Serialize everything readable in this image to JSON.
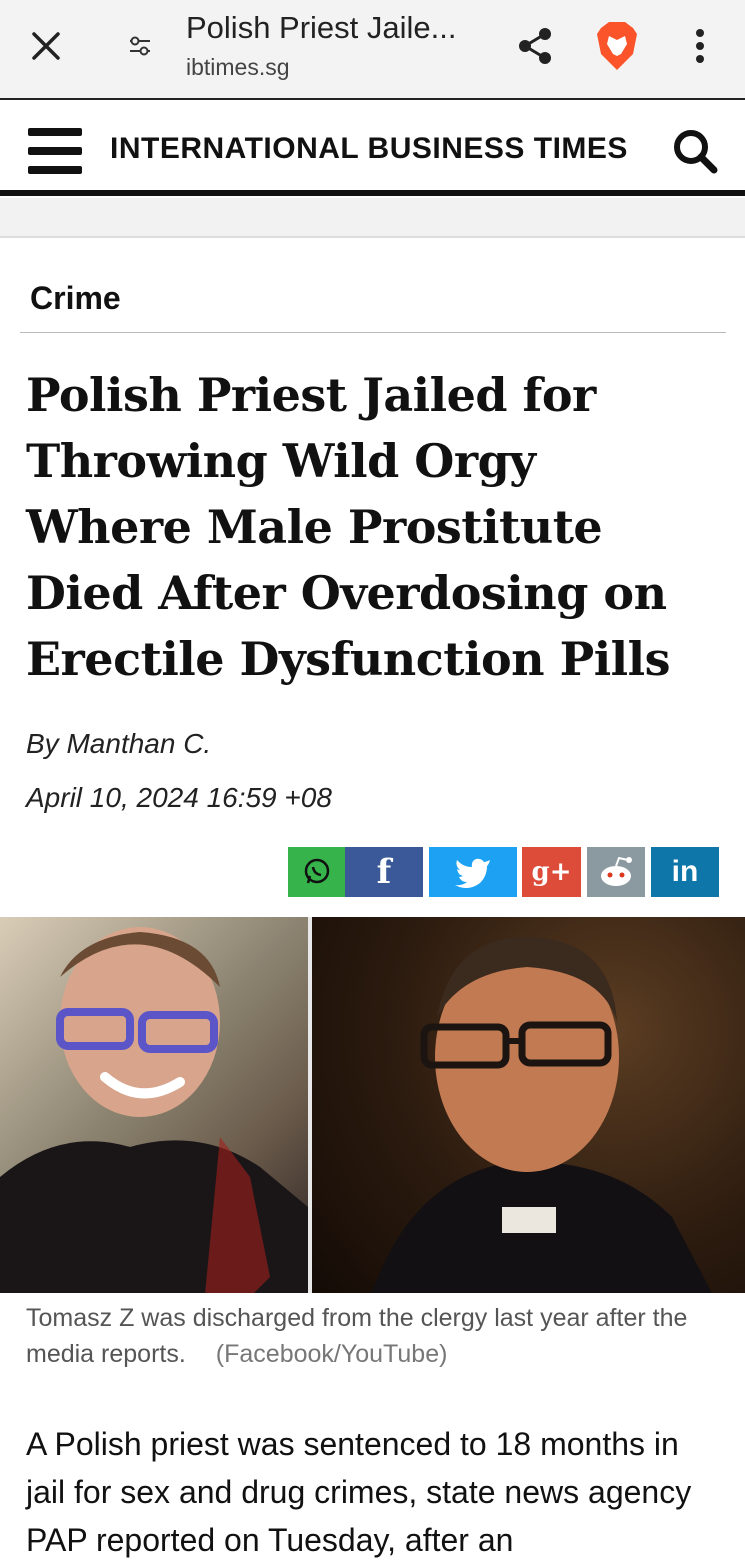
{
  "browser": {
    "tab_title": "Polish Priest Jaile...",
    "url": "ibtimes.sg"
  },
  "site": {
    "brand": "INTERNATIONAL BUSINESS TIMES"
  },
  "article": {
    "category": "Crime",
    "headline": "Polish Priest Jailed for Throwing Wild Orgy Where Male Prostitute Died After Overdosing on Erectile Dysfunction Pills",
    "byline_prefix": "By",
    "author": "Manthan C.",
    "date": "April 10, 2024 16:59 +08",
    "caption": "Tomasz Z was discharged from the clergy last year after the media reports.",
    "caption_credit": "(Facebook/YouTube)",
    "body": "A Polish priest was sentenced to 18 months in jail for sex and drug crimes, state news agency PAP reported on Tuesday, after an"
  },
  "share_buttons": {
    "facebook": "f",
    "googleplus": "g+",
    "linkedin": "in"
  },
  "colors": {
    "whatsapp": "#36b34a",
    "facebook": "#3b5998",
    "twitter": "#1da1f2",
    "googleplus": "#dd4b39",
    "reddit": "#8a9aa0",
    "linkedin": "#0e76a8",
    "brave": "#fb542b"
  }
}
